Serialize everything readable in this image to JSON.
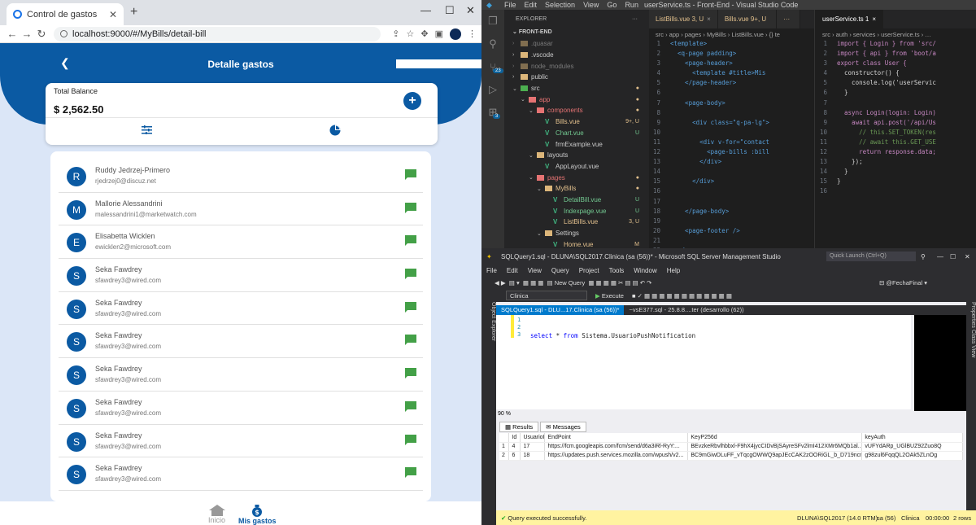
{
  "browser": {
    "tab_title": "Control de gastos",
    "url": "localhost:9000/#/MyBills/detail-bill"
  },
  "app": {
    "header_title": "Detalle gastos",
    "balance_label": "Total Balance",
    "balance_amount": "$ 2,562.50",
    "contacts": [
      {
        "initial": "R",
        "name": "Ruddy Jedrzej-Primero",
        "email": "rjedrzej0@discuz.net"
      },
      {
        "initial": "M",
        "name": "Mallorie Alessandrini",
        "email": "malessandrini1@marketwatch.com"
      },
      {
        "initial": "E",
        "name": "Elisabetta Wicklen",
        "email": "ewicklen2@microsoft.com"
      },
      {
        "initial": "S",
        "name": "Seka Fawdrey",
        "email": "sfawdrey3@wired.com"
      },
      {
        "initial": "S",
        "name": "Seka Fawdrey",
        "email": "sfawdrey3@wired.com"
      },
      {
        "initial": "S",
        "name": "Seka Fawdrey",
        "email": "sfawdrey3@wired.com"
      },
      {
        "initial": "S",
        "name": "Seka Fawdrey",
        "email": "sfawdrey3@wired.com"
      },
      {
        "initial": "S",
        "name": "Seka Fawdrey",
        "email": "sfawdrey3@wired.com"
      },
      {
        "initial": "S",
        "name": "Seka Fawdrey",
        "email": "sfawdrey3@wired.com"
      },
      {
        "initial": "S",
        "name": "Seka Fawdrey",
        "email": "sfawdrey3@wired.com"
      }
    ],
    "nav": {
      "home": "Inicio",
      "bills": "Mis gastos"
    },
    "colors": {
      "primary": "#0b5aa3",
      "chat": "#43a047"
    }
  },
  "vscode": {
    "menu": [
      "File",
      "Edit",
      "Selection",
      "View",
      "Go",
      "Run",
      "···"
    ],
    "title": "userService.ts - Front-End - Visual Studio Code",
    "explorer_label": "EXPLORER",
    "root": "FRONT-END",
    "activity_badges": {
      "git": "23",
      "ext": "3"
    },
    "tree": [
      {
        "depth": 1,
        "chev": "›",
        "kind": "folder",
        "name": ".quasar",
        "status": "",
        "dim": true
      },
      {
        "depth": 1,
        "chev": "›",
        "kind": "folder",
        "name": ".vscode",
        "status": ""
      },
      {
        "depth": 1,
        "chev": "›",
        "kind": "folder",
        "name": "node_modules",
        "status": "",
        "dim": true
      },
      {
        "depth": 1,
        "chev": "›",
        "kind": "folder",
        "name": "public",
        "status": ""
      },
      {
        "depth": 1,
        "chev": "⌄",
        "kind": "folder-src",
        "name": "src",
        "status": "●",
        "mod": true
      },
      {
        "depth": 2,
        "chev": "⌄",
        "kind": "folder-red",
        "name": "app",
        "status": "●",
        "mod": true
      },
      {
        "depth": 3,
        "chev": "⌄",
        "kind": "folder-red",
        "name": "components",
        "status": "●",
        "mod": true
      },
      {
        "depth": 4,
        "chev": "",
        "kind": "vue",
        "name": "Bills.vue",
        "status": "9+, U",
        "mod": true
      },
      {
        "depth": 4,
        "chev": "",
        "kind": "vue",
        "name": "Chart.vue",
        "status": "U",
        "new": true
      },
      {
        "depth": 4,
        "chev": "",
        "kind": "vue",
        "name": "frmExample.vue",
        "status": ""
      },
      {
        "depth": 3,
        "chev": "⌄",
        "kind": "folder",
        "name": "layouts",
        "status": ""
      },
      {
        "depth": 4,
        "chev": "",
        "kind": "vue",
        "name": "AppLayout.vue",
        "status": ""
      },
      {
        "depth": 3,
        "chev": "⌄",
        "kind": "folder-red",
        "name": "pages",
        "status": "●",
        "mod": true
      },
      {
        "depth": 4,
        "chev": "⌄",
        "kind": "folder",
        "name": "MyBills",
        "status": "●",
        "mod": true
      },
      {
        "depth": 5,
        "chev": "",
        "kind": "vue",
        "name": "DetailBill.vue",
        "status": "U",
        "new": true
      },
      {
        "depth": 5,
        "chev": "",
        "kind": "vue",
        "name": "Indexpage.vue",
        "status": "U",
        "new": true
      },
      {
        "depth": 5,
        "chev": "",
        "kind": "vue",
        "name": "ListBills.vue",
        "status": "3, U",
        "mod": true
      },
      {
        "depth": 4,
        "chev": "⌄",
        "kind": "folder",
        "name": "Settings",
        "status": ""
      },
      {
        "depth": 5,
        "chev": "",
        "kind": "vue",
        "name": "Home.vue",
        "status": "M",
        "mod": true
      }
    ],
    "editor1": {
      "tabs": [
        {
          "name": "ListBills.vue 3, U",
          "active": false,
          "close": "×"
        },
        {
          "name": "Bills.vue 9+, U",
          "active": false,
          "close": ""
        },
        {
          "name": "···",
          "active": false,
          "close": ""
        }
      ],
      "breadcrumb": "src › app › pages › MyBills ›  ListBills.vue › {} te",
      "lines": [
        [
          "1",
          "<template>"
        ],
        [
          "2",
          "  <q-page padding>"
        ],
        [
          "3",
          "    <page-header>"
        ],
        [
          "4",
          "      <template #title>Mis"
        ],
        [
          "5",
          "    </page-header>"
        ],
        [
          "6",
          ""
        ],
        [
          "7",
          "    <page-body>"
        ],
        [
          "8",
          ""
        ],
        [
          "9",
          "      <div class=\"q-pa-lg\">"
        ],
        [
          "10",
          ""
        ],
        [
          "11",
          "        <div v-for=\"contact"
        ],
        [
          "12",
          "          <page-bills :bill"
        ],
        [
          "13",
          "        </div>"
        ],
        [
          "14",
          ""
        ],
        [
          "15",
          "      </div>"
        ],
        [
          "16",
          ""
        ],
        [
          "17",
          ""
        ],
        [
          "18",
          "    </page-body>"
        ],
        [
          "19",
          ""
        ],
        [
          "20",
          "    <page-footer />"
        ],
        [
          "21",
          ""
        ],
        [
          "22",
          "  </q-page>"
        ]
      ]
    },
    "editor2": {
      "tabs": [
        {
          "name": "userService.ts 1",
          "active": true,
          "close": "×"
        }
      ],
      "breadcrumb": "src › auth › services ›  userService.ts › …",
      "lines": [
        [
          "1",
          "import { Login } from 'src/"
        ],
        [
          "2",
          "import { api } from 'boot/a"
        ],
        [
          "3",
          "export class User {"
        ],
        [
          "4",
          "  constructor() {"
        ],
        [
          "5",
          "    console.log('userServic"
        ],
        [
          "6",
          "  }"
        ],
        [
          "7",
          ""
        ],
        [
          "8",
          "  async Login(login: Login)"
        ],
        [
          "9",
          "    await api.post('/api/Us"
        ],
        [
          "10",
          "      // this.SET_TOKEN(res"
        ],
        [
          "11",
          "      // await this.GET_USE"
        ],
        [
          "12",
          "      return response.data;"
        ],
        [
          "13",
          "    });"
        ],
        [
          "14",
          "  }"
        ],
        [
          "15",
          "}"
        ],
        [
          "16",
          ""
        ]
      ]
    }
  },
  "ssms": {
    "title": "SQLQuery1.sql - DLUNA\\SQL2017.Clinica (sa (56))* - Microsoft SQL Server Management Studio",
    "quick_launch": "Quick Launch (Ctrl+Q)",
    "menu": [
      "File",
      "Edit",
      "View",
      "Query",
      "Project",
      "Tools",
      "Window",
      "Help"
    ],
    "new_query": "New Query",
    "param": "@FechaFinal",
    "database": "Clinica",
    "execute": "Execute",
    "side_left": "Object Explorer",
    "side_right": "Properties   Class View",
    "query_tabs": [
      {
        "name": "SQLQuery1.sql - DLU...17.Clinica (sa (56))*",
        "active": true
      },
      {
        "name": "~vsE377.sql - 25.8.8....ter (desarrollo (62))",
        "active": false
      }
    ],
    "query_keyword1": "select",
    "query_rest1": " * ",
    "query_keyword2": "from",
    "query_rest2": " Sistema.UsuarioPushNotification",
    "line_numbers": [
      "1",
      "2",
      "3"
    ],
    "zoom": "90 %",
    "result_tabs": [
      "Results",
      "Messages"
    ],
    "columns": [
      "",
      "Id",
      "UsuarioId",
      "EndPoint",
      "KeyP256d",
      "keyAuth"
    ],
    "rows": [
      [
        "1",
        "4",
        "17",
        "https://fcm.googleapis.com/fcm/send/d6a3iRl-RyY:...",
        "BEvzkeRbvlhbbxl-F9hX4jycCIDvBjSAyreSFv2lmI412XMr6MQb1al...",
        "vUFYdARp_UGlBUZ92Zuo8Q"
      ],
      [
        "2",
        "6",
        "18",
        "https://updates.push.services.mozilla.com/wpush/v2...",
        "BC9mGiwDLuFF_vTqcgOWWQ9apJEcCAK2zOORiGL_b_D719ncn...",
        "g98zul6FqqQL2OAk5ZLnOg"
      ]
    ],
    "status_msg": "Query executed successfully.",
    "status_server": "DLUNA\\SQL2017 (14.0 RTM)",
    "status_user": "sa (56)",
    "status_db": "Clinica",
    "status_time": "00:00:00",
    "status_rows": "2 rows"
  }
}
